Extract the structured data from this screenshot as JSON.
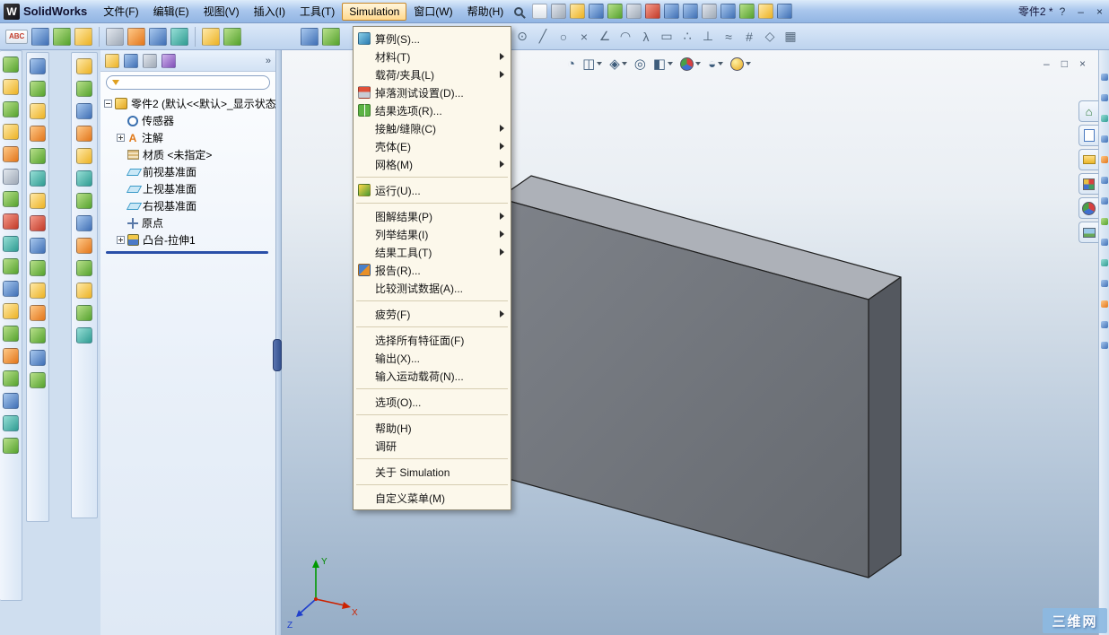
{
  "titlebar": {
    "logo_glyph": "W",
    "app_name": "SolidWorks",
    "doc_title": "零件2 *",
    "menus": [
      "文件(F)",
      "编辑(E)",
      "视图(V)",
      "插入(I)",
      "工具(T)",
      "Simulation",
      "窗口(W)",
      "帮助(H)"
    ],
    "active_menu": "Simulation",
    "help": "?",
    "minimize": "–",
    "close": "×"
  },
  "toolbar2": {
    "spell": "ABC",
    "sketch_glyphs": [
      "⊙",
      "╱",
      "○",
      "×",
      "∠",
      "◠",
      "λ",
      "▭",
      "∴",
      "⊥",
      "≈",
      "#",
      "◇",
      "▦"
    ]
  },
  "simulation_menu": {
    "title": "Simulation",
    "items": [
      "算例(S)...",
      "材料(T)",
      "载荷/夹具(L)",
      "掉落测试设置(D)...",
      "结果选项(R)...",
      "接触/缝隙(C)",
      "壳体(E)",
      "网格(M)",
      "运行(U)...",
      "图解结果(P)",
      "列举结果(I)",
      "结果工具(T)",
      "报告(R)...",
      "比较测试数据(A)...",
      "疲劳(F)",
      "选择所有特征面(F)",
      "输出(X)...",
      "输入运动载荷(N)...",
      "选项(O)...",
      "帮助(H)",
      "调研",
      "关于 Simulation",
      "自定义菜单(M)"
    ]
  },
  "feature_panel": {
    "more_glyph": "»",
    "root_label": "零件2 (默认<<默认>_显示状态",
    "annotation_glyph": "A",
    "items": [
      "传感器",
      "注解",
      "材质 <未指定>",
      "前视基准面",
      "上视基准面",
      "右视基准面",
      "原点",
      "凸台-拉伸1"
    ]
  },
  "viewport": {
    "headsup_glyphs": [
      "◔",
      "◫",
      "◈",
      "◎",
      "◧",
      "◒"
    ],
    "doc_minimize": "–",
    "doc_restore": "□",
    "doc_close": "×",
    "triad": {
      "x": "X",
      "y": "Y",
      "z": "Z"
    },
    "watermark": "三维网"
  },
  "task_pane": {
    "home_glyph": "⌂"
  },
  "colors": {
    "titlebar_blue": "#aac7ed",
    "menu_cream": "#fcf8eb",
    "active_menu_border": "#c8882a",
    "viewport_top": "#f4f6f9",
    "viewport_bottom": "#96adc6",
    "part_front": "#73777e",
    "part_top": "#adb1b8",
    "part_side": "#54585f",
    "rollback_blue": "#2a4fa8",
    "triad_x": "#cc2200",
    "triad_y": "#009900",
    "triad_z": "#2040cc"
  }
}
